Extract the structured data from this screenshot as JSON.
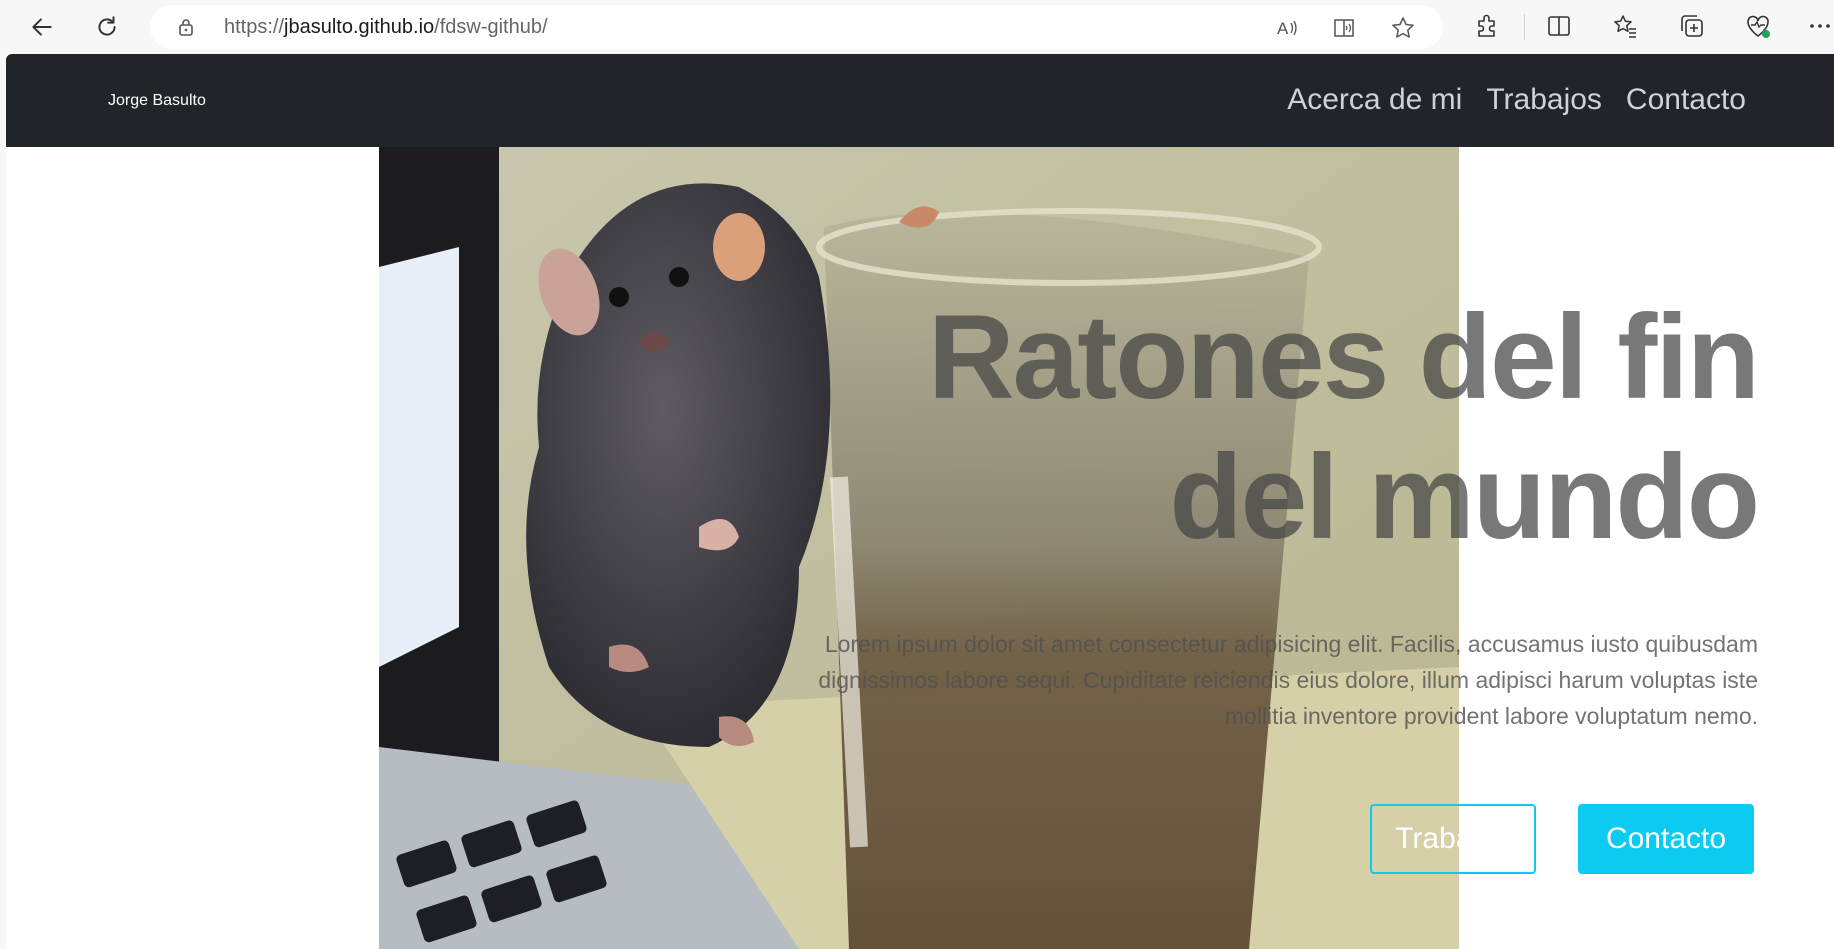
{
  "browser": {
    "url_scheme": "https://",
    "url_host": "jbasulto.github.io",
    "url_path": "/fdsw-github/",
    "icons": [
      "back-icon",
      "refresh-icon",
      "lock-icon",
      "read-aloud-icon",
      "immersive-reader-icon",
      "favorite-star-icon",
      "extensions-icon",
      "split-screen-icon",
      "favorites-icon",
      "collections-icon",
      "browser-essentials-icon",
      "more-icon"
    ]
  },
  "site": {
    "brand": "Jorge Basulto",
    "nav": [
      "Acerca de mi",
      "Trabajos",
      "Contacto"
    ]
  },
  "hero": {
    "title_line1": "Ratones del fin",
    "title_line2": "del mundo",
    "lead": "Lorem ipsum dolor sit amet consectetur adipisicing elit. Facilis, accusamus iusto quibusdam dignissimos labore sequi. Cupiditate reiciendis eius dolore, illum adipisci harum voluptas iste mollitia inventore provident labore voluptatum nemo.",
    "button_outline": "Trabajos",
    "button_solid": "Contacto",
    "accent_color": "#0dcaf0"
  }
}
